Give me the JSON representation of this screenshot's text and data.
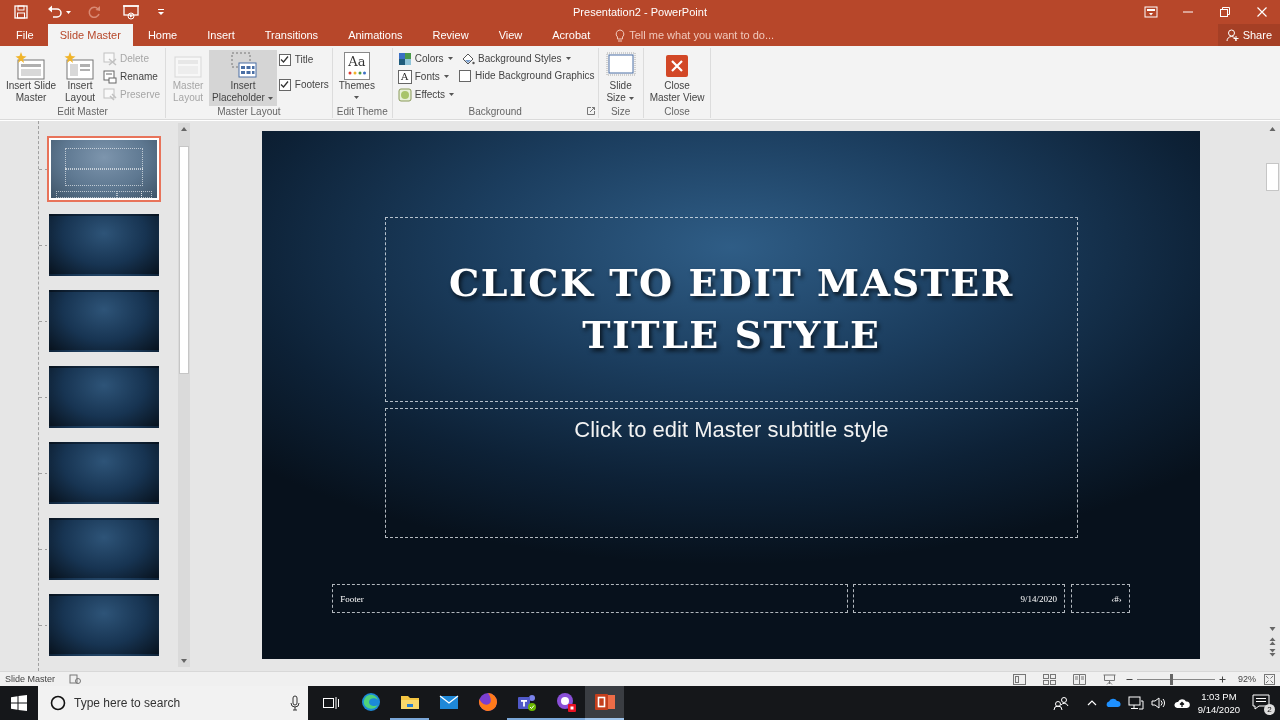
{
  "window": {
    "title": "Presentation2 - PowerPoint"
  },
  "tabs": [
    {
      "label": "File",
      "selected": false
    },
    {
      "label": "Slide Master",
      "selected": true
    },
    {
      "label": "Home",
      "selected": false
    },
    {
      "label": "Insert",
      "selected": false
    },
    {
      "label": "Transitions",
      "selected": false
    },
    {
      "label": "Animations",
      "selected": false
    },
    {
      "label": "Review",
      "selected": false
    },
    {
      "label": "View",
      "selected": false
    },
    {
      "label": "Acrobat",
      "selected": false
    }
  ],
  "tell_me": {
    "placeholder": "Tell me what you want to do..."
  },
  "share": {
    "label": "Share"
  },
  "ribbon": {
    "groups": [
      {
        "label": "Edit Master",
        "launcher": false,
        "columns": [
          [
            {
              "kind": "large",
              "label": "Insert Slide\nMaster",
              "disabled": false,
              "dropdown": false,
              "hovered": false
            }
          ],
          [
            {
              "kind": "large",
              "label": "Insert\nLayout",
              "disabled": false,
              "dropdown": false,
              "hovered": false
            }
          ],
          [
            {
              "kind": "small",
              "label": "Delete",
              "disabled": true,
              "dropdown": false,
              "hovered": false
            },
            {
              "kind": "small",
              "label": "Rename",
              "disabled": false,
              "dropdown": false,
              "hovered": false
            },
            {
              "kind": "small",
              "label": "Preserve",
              "disabled": true,
              "dropdown": false,
              "hovered": false
            }
          ]
        ]
      },
      {
        "label": "Master Layout",
        "launcher": false,
        "columns": [
          [
            {
              "kind": "large",
              "label": "Master\nLayout",
              "disabled": true,
              "dropdown": false,
              "hovered": false
            }
          ],
          [
            {
              "kind": "large",
              "label": "Insert\nPlaceholder",
              "disabled": false,
              "dropdown": true,
              "hovered": true
            }
          ],
          [
            {
              "kind": "check",
              "label": "Title",
              "checked": true
            },
            {
              "kind": "check",
              "label": "Footers",
              "checked": true
            }
          ]
        ]
      },
      {
        "label": "Edit Theme",
        "launcher": false,
        "columns": [
          [
            {
              "kind": "large",
              "label": "Themes",
              "glyph": "Aa",
              "disabled": false,
              "dropdown": true,
              "hovered": false
            }
          ]
        ]
      },
      {
        "label": "Background",
        "launcher": true,
        "columns": [
          [
            {
              "kind": "small",
              "label": "Colors",
              "disabled": false,
              "dropdown": true,
              "hovered": false
            },
            {
              "kind": "small",
              "label": "Fonts",
              "glyph": "A",
              "disabled": false,
              "dropdown": true,
              "hovered": false
            },
            {
              "kind": "small",
              "label": "Effects",
              "disabled": false,
              "dropdown": true,
              "hovered": false
            }
          ],
          [
            {
              "kind": "small",
              "label": "Background Styles",
              "disabled": false,
              "dropdown": true,
              "hovered": false
            },
            {
              "kind": "check",
              "label": "Hide Background Graphics",
              "checked": false
            }
          ]
        ]
      },
      {
        "label": "Size",
        "launcher": false,
        "columns": [
          [
            {
              "kind": "large",
              "label": "Slide\nSize",
              "disabled": false,
              "dropdown": true,
              "hovered": false
            }
          ]
        ]
      },
      {
        "label": "Close",
        "launcher": false,
        "columns": [
          [
            {
              "kind": "large",
              "label": "Close\nMaster View",
              "disabled": false,
              "dropdown": false,
              "hovered": false
            }
          ]
        ]
      }
    ]
  },
  "slide_panel": {
    "thumbnails": [
      {
        "kind": "master",
        "selected": true
      },
      {
        "kind": "layout",
        "selected": false
      },
      {
        "kind": "layout",
        "selected": false
      },
      {
        "kind": "layout",
        "selected": false
      },
      {
        "kind": "layout",
        "selected": false
      },
      {
        "kind": "layout",
        "selected": false
      },
      {
        "kind": "layout",
        "selected": false
      }
    ]
  },
  "slide": {
    "title": "CLICK TO EDIT MASTER TITLE STYLE",
    "subtitle": "Click to edit Master subtitle style",
    "footer": "Footer",
    "date": "9/14/2020",
    "number": "‹#›"
  },
  "status_bar": {
    "mode": "Slide Master",
    "zoom": "92%",
    "zoom_slider": {
      "level": 0.44
    }
  },
  "taskbar": {
    "search": {
      "placeholder": "Type here to search"
    },
    "apps": [
      {
        "running": false,
        "active": false
      },
      {
        "running": true,
        "active": false
      },
      {
        "running": false,
        "active": false
      },
      {
        "running": false,
        "active": false
      },
      {
        "running": true,
        "active": false
      },
      {
        "running": true,
        "active": false
      },
      {
        "running": true,
        "active": true
      }
    ],
    "time": "1:03 PM",
    "date": "9/14/2020",
    "notifications": "2"
  }
}
